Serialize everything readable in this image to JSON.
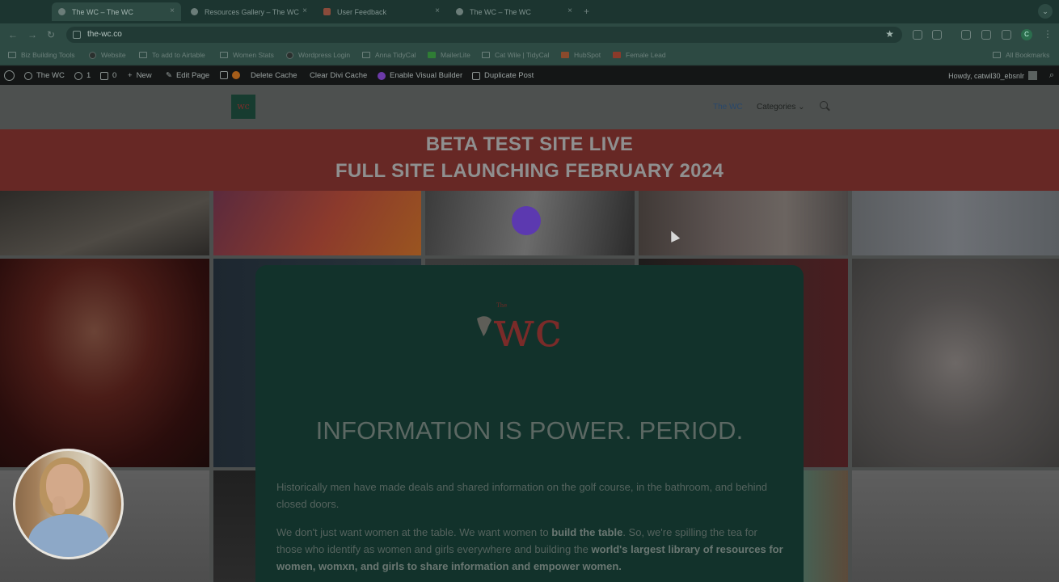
{
  "browser": {
    "tabs": [
      {
        "title": "The WC – The WC",
        "active": true
      },
      {
        "title": "Resources Gallery – The WC",
        "active": false
      },
      {
        "title": "User Feedback",
        "active": false
      },
      {
        "title": "The WC – The WC",
        "active": false
      }
    ],
    "new_tab": "+",
    "url": "the-wc.co",
    "bookmarks": [
      "Biz Building Tools",
      "Website",
      "To add to Airtable",
      "Women Stats",
      "Wordpress Login",
      "Anna TidyCal",
      "MailerLite",
      "Cat Wile | TidyCal",
      "HubSpot",
      "Female Lead"
    ],
    "all_bookmarks": "All Bookmarks",
    "profile_initial": "C"
  },
  "wp_admin": {
    "site_name": "The WC",
    "updates": "1",
    "comments": "0",
    "new": "New",
    "edit_page": "Edit Page",
    "delete_cache": "Delete Cache",
    "clear_divi_cache": "Clear Divi Cache",
    "visual_builder": "Enable Visual Builder",
    "duplicate_post": "Duplicate Post",
    "howdy": "Howdy, catwil30_ebsnlr"
  },
  "site": {
    "logo_text": "wc",
    "nav": {
      "active": "The WC",
      "categories": "Categories"
    },
    "banner": {
      "line1": "BETA TEST SITE LIVE",
      "line2": "FULL SITE LAUNCHING FEBRUARY 2024"
    },
    "modal": {
      "logo_small": "The",
      "logo_text": "wc",
      "heading": "INFORMATION IS POWER. PERIOD.",
      "p1": "Historically men have made deals and shared information on the golf course, in the bathroom, and behind closed doors.",
      "p2_a": "We don't just want women at the table. We want women to ",
      "p2_b": "build the table",
      "p2_c": ". So, we're spilling the tea for those who identify as women and girls everywhere and building the ",
      "p2_d": "world's largest library of resources for women, womxn, and girls to share information and empower women."
    }
  },
  "icons": {
    "back": "←",
    "forward": "→",
    "reload": "↻",
    "star": "★",
    "close": "×",
    "chevron": "⌄",
    "kebab": "⋮"
  }
}
